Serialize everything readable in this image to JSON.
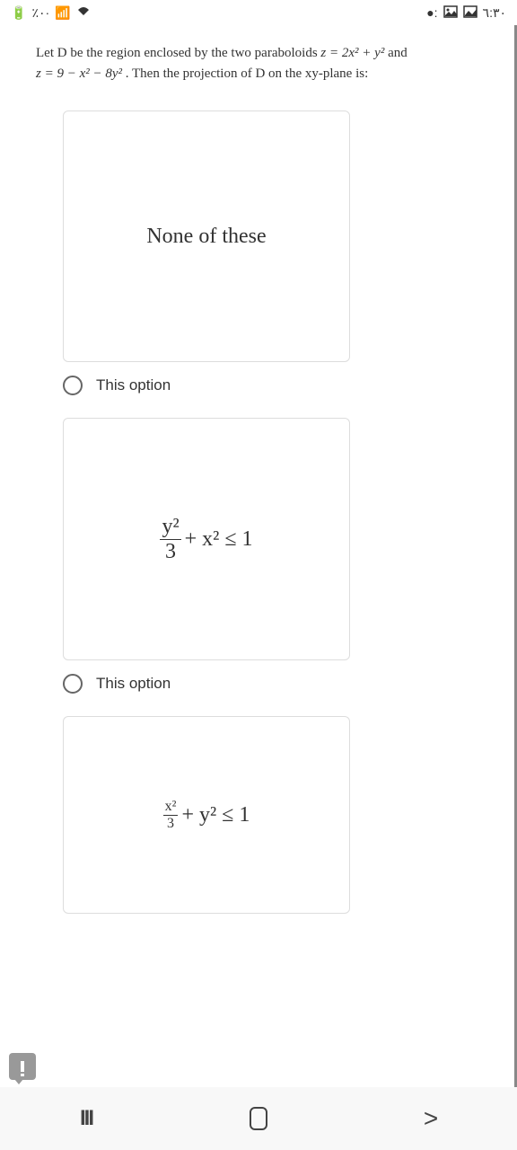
{
  "status_bar": {
    "battery": "٪٠·",
    "signal_icon": "signal",
    "wifi_icon": "wifi",
    "camera_icon": "camera",
    "picture_icon": "picture",
    "gallery_icon": "gallery",
    "time": "٦:٣٠"
  },
  "question": {
    "line1_prefix": "Let D be the region enclosed by the two paraboloids ",
    "eq1": "z = 2x² + y²",
    "line1_suffix": " and",
    "line2_prefix": "",
    "eq2": "z = 9 − x² − 8y²",
    "line2_suffix": " . Then the projection of D on the xy-plane is:"
  },
  "options": [
    {
      "card_text": "None of these",
      "label": "This option"
    },
    {
      "formula_frac_top": "y²",
      "formula_frac_bot": "3",
      "formula_rest": " + x² ≤ 1",
      "label": "This option"
    },
    {
      "formula_frac_top": "x²",
      "formula_frac_bot": "3",
      "formula_rest": " + y² ≤ 1",
      "label": ""
    }
  ],
  "nav": {
    "recents": "III",
    "back": ">"
  }
}
